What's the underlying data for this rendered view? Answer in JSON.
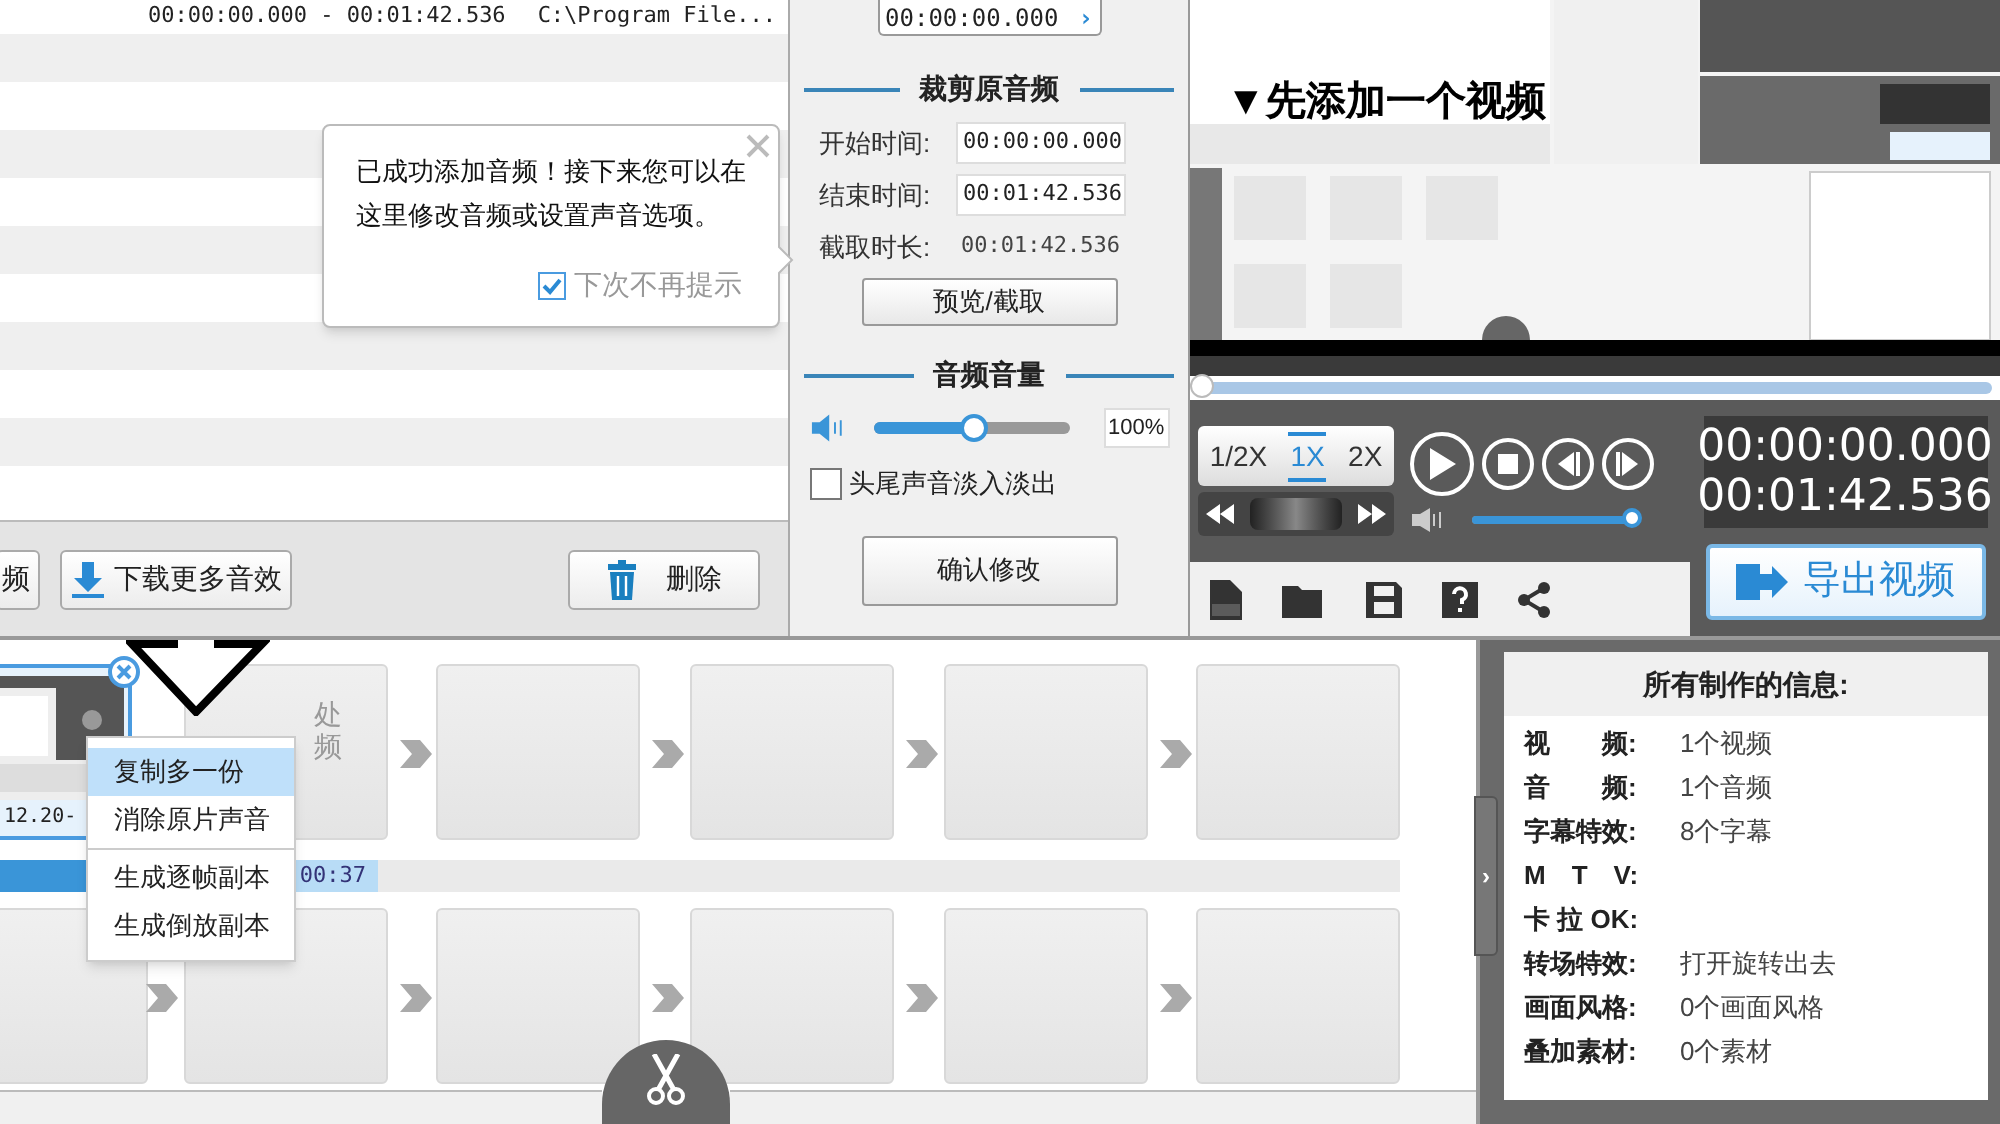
{
  "audio_list": {
    "rows": [
      {
        "time": "00:00:00.000 - 00:01:42.536",
        "path": "C:\\Program File..."
      }
    ],
    "buttons": [
      {
        "label": "频"
      },
      {
        "label": "下载更多音效"
      },
      {
        "label": "删除"
      }
    ]
  },
  "tooltip": {
    "text": "已成功添加音频！接下来您可以在这里修改音频或设置声音选项。",
    "checkbox": {
      "label": "下次不再提示",
      "checked": true
    }
  },
  "audio_edit": {
    "time_field": "00:00:00.000",
    "time_arrow": "›",
    "trim_title": "裁剪原音频",
    "fields": [
      {
        "label": "开始时间:",
        "value": "00:00:00.000",
        "kind": "input"
      },
      {
        "label": "结束时间:",
        "value": "00:01:42.536",
        "kind": "input"
      },
      {
        "label": "截取时长:",
        "value": "00:01:42.536",
        "kind": "text"
      }
    ],
    "preview_button": "预览/截取",
    "volume_title": "音频音量",
    "volume": {
      "level": 0.51,
      "value": "100%"
    },
    "fade": {
      "label": "头尾声音淡入淡出",
      "checked": false
    },
    "confirm_button": "确认修改"
  },
  "preview": {
    "caption": "▼先添加一个视频",
    "progress": {
      "level": 0
    },
    "speeds": [
      {
        "label": "1/2X",
        "selected": false
      },
      {
        "label": "1X",
        "selected": true
      },
      {
        "label": "2X",
        "selected": false
      }
    ],
    "volume": {
      "level": 1
    },
    "current_time": "00:00:00.000",
    "total_time": "00:01:42.536",
    "export_button": "导出视频"
  },
  "timeline": {
    "rows": [
      {
        "tiles": [
          {
            "kind": "clip",
            "name": "12.20-",
            "selected": true
          },
          {
            "kind": "hint",
            "lines": [
              "处",
              "频"
            ]
          },
          {
            "kind": "empty"
          },
          {
            "kind": "empty"
          },
          {
            "kind": "empty"
          },
          {
            "kind": "empty"
          }
        ]
      },
      {
        "tiles": [
          {
            "kind": "empty"
          },
          {
            "kind": "empty"
          },
          {
            "kind": "empty"
          },
          {
            "kind": "empty"
          },
          {
            "kind": "empty"
          },
          {
            "kind": "empty"
          }
        ]
      }
    ],
    "time_bar": {
      "label": "00:37",
      "level": 0.27
    }
  },
  "context_menu": {
    "groups": [
      {
        "items": [
          {
            "label": "复制多一份",
            "selected": true
          },
          {
            "label": "消除原片声音",
            "selected": false
          }
        ]
      },
      {
        "items": [
          {
            "label": "生成逐帧副本",
            "selected": false
          },
          {
            "label": "生成倒放副本",
            "selected": false
          }
        ]
      }
    ]
  },
  "info_panel": {
    "toggle": "›",
    "title": "所有制作的信息:",
    "rows": [
      {
        "label": "视　　频:",
        "value": "1个视频"
      },
      {
        "label": "音　　频:",
        "value": "1个音频"
      },
      {
        "label": "字幕特效:",
        "value": "8个字幕"
      },
      {
        "label": "M　T　V:"
      },
      {
        "label": "卡 拉 OK:"
      },
      {
        "label": "转场特效:",
        "value": "打开旋转出去"
      },
      {
        "label": "画面风格:",
        "value": "0个画面风格"
      },
      {
        "label": "叠加素材:",
        "value": "0个素材"
      }
    ]
  }
}
